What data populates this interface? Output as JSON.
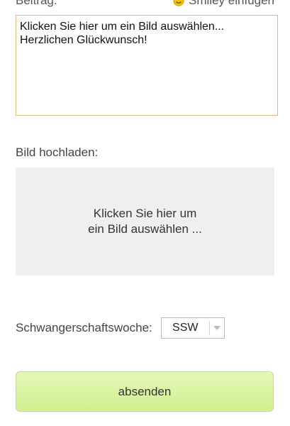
{
  "form": {
    "beitrag_label": "Beitrag:",
    "smiley_link_label": "Smiley einfügen",
    "message_value": "Klicken Sie hier um ein Bild auswählen...\nHerzlichen Glückwunsch!",
    "bild_label": "Bild hochladen:",
    "upload_text_line1": "Klicken Sie hier um",
    "upload_text_line2": "ein Bild auswählen ...",
    "ssw_label": "Schwangerschaftswoche:",
    "ssw_selected": "SSW",
    "submit_label": "absenden"
  },
  "icons": {
    "smiley": "smiley-icon",
    "dropdown": "chevron-down-icon"
  },
  "colors": {
    "textarea_border": "#e2b77c",
    "upload_bg": "#efefef",
    "submit_bg": "#d8f39d",
    "smiley": "#f2c200"
  }
}
